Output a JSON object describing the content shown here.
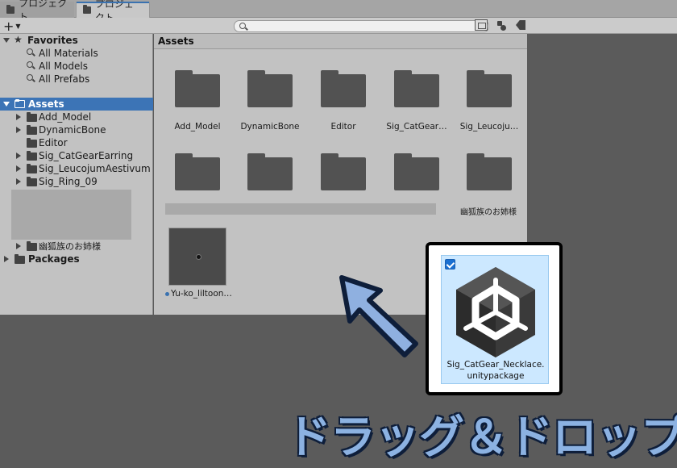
{
  "tabs": [
    {
      "label": "プロジェクト",
      "active": false
    },
    {
      "label": "プロジェクト",
      "active": true
    }
  ],
  "toolbar": {
    "add_label": "+",
    "search_placeholder": ""
  },
  "tree": {
    "favorites_label": "Favorites",
    "favorites": [
      "All Materials",
      "All Models",
      "All Prefabs"
    ],
    "assets_label": "Assets",
    "asset_children": [
      "Add_Model",
      "DynamicBone",
      "Editor",
      "Sig_CatGearEarring",
      "Sig_LeucojumAestivum",
      "Sig_Ring_09",
      "幽狐族のお姉様"
    ],
    "packages_label": "Packages"
  },
  "main": {
    "header": "Assets",
    "folder_row_1": [
      "Add_Model",
      "DynamicBone",
      "Editor",
      "Sig_CatGear…",
      "Sig_Leucoju…"
    ],
    "folder_row_2_last_label": "幽狐族のお姉様",
    "material_label": "Yu-ko_liltoon…"
  },
  "package": {
    "name_line1": "Sig_CatGear_Necklace.",
    "name_line2": "unitypackage"
  },
  "caption": "ドラッグ＆ドロップ",
  "colors": {
    "selection_blue": "#3c74b6",
    "caption_fill": "#8cb2e2",
    "caption_outline": "#0e1e3a",
    "arrow_fill": "#8fb0e0"
  }
}
